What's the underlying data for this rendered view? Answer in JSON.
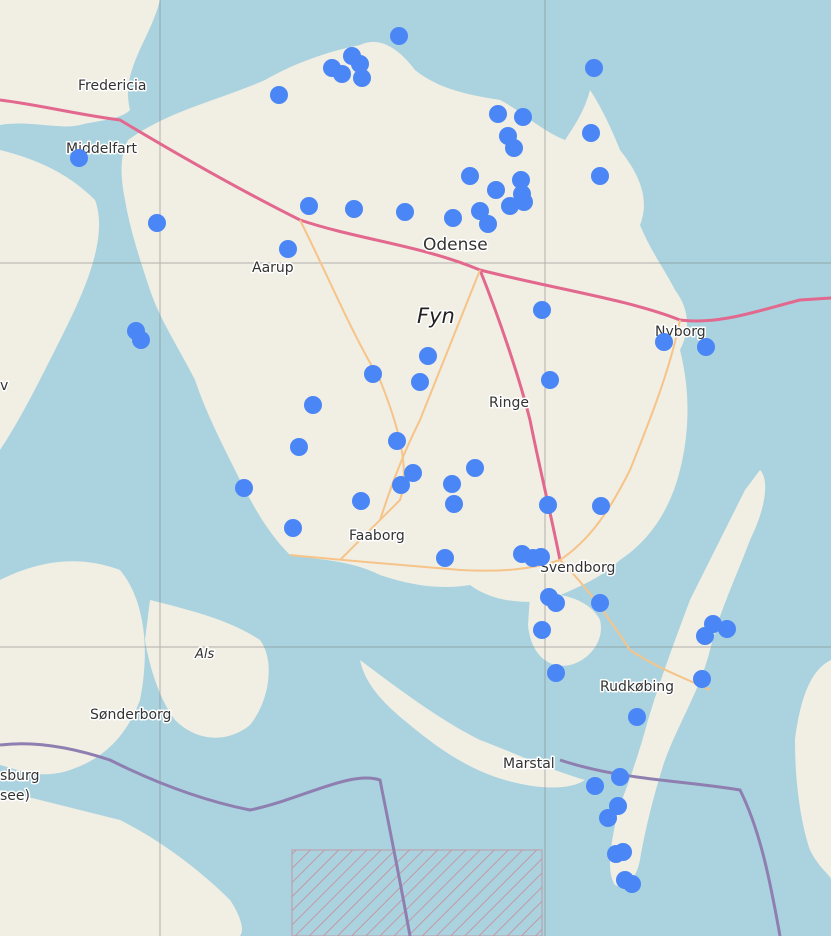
{
  "map": {
    "colors": {
      "water": "#aad3df",
      "land": "#f1eee4",
      "road_primary": "#e2688e",
      "road_secondary": "#f6c489",
      "border": "#8e7fb0",
      "marker": "#4a86f5"
    },
    "labels": {
      "fredericia": "Fredericia",
      "middelfart": "Middelfart",
      "odense": "Odense",
      "aarup": "Aarup",
      "fyn": "Fyn",
      "nyborg": "Nyborg",
      "ringe": "Ringe",
      "faaborg": "Faaborg",
      "svendborg": "Svendborg",
      "rudkobing": "Rudkøbing",
      "als": "Als",
      "sonderborg": "Sønderborg",
      "marstal": "Marstal",
      "flensburg_1": "sburg",
      "flensburg_2": "see)",
      "edge_v": "v"
    },
    "marker_count": 73
  }
}
